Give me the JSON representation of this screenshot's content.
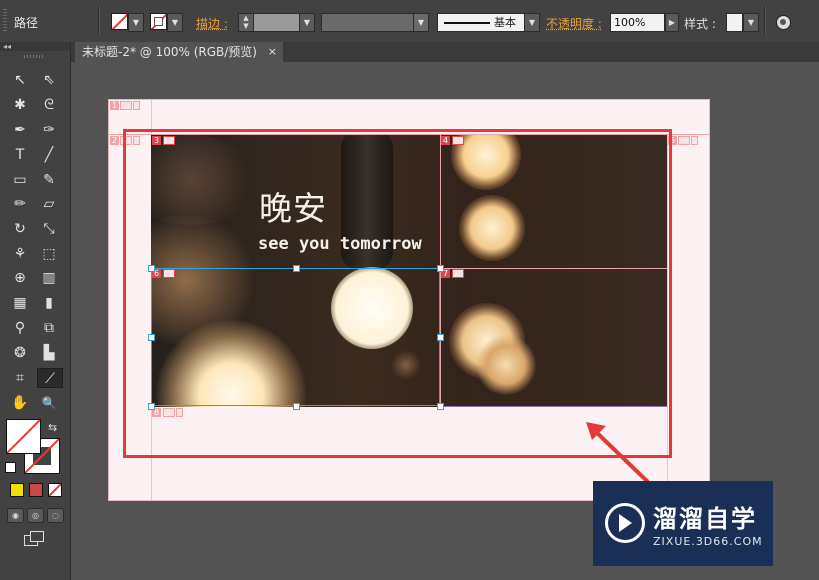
{
  "control_bar": {
    "tool_name": "路径",
    "stroke_label": "描边 :",
    "stroke_profile_label": "基本",
    "opacity_label": "不透明度 :",
    "opacity_value": "100%",
    "style_label": "样式 :",
    "fill_swatch": "none",
    "stroke_swatch": "none"
  },
  "document_tab": {
    "title": "未标题-2* @ 100% (RGB/预览)",
    "close_glyph": "×"
  },
  "toolbox": {
    "collapse_glyph": "◂◂",
    "tools": [
      {
        "name": "selection-tool-icon",
        "glyph": "↖"
      },
      {
        "name": "direct-selection-tool-icon",
        "glyph": "⇖"
      },
      {
        "name": "magic-wand-tool-icon",
        "glyph": "✱"
      },
      {
        "name": "lasso-tool-icon",
        "glyph": "ᘓ"
      },
      {
        "name": "pen-tool-icon",
        "glyph": "✒"
      },
      {
        "name": "curvature-tool-icon",
        "glyph": "✑"
      },
      {
        "name": "type-tool-icon",
        "glyph": "T"
      },
      {
        "name": "line-tool-icon",
        "glyph": "╱"
      },
      {
        "name": "rectangle-tool-icon",
        "glyph": "▭"
      },
      {
        "name": "paintbrush-tool-icon",
        "glyph": "✎"
      },
      {
        "name": "pencil-tool-icon",
        "glyph": "✏"
      },
      {
        "name": "eraser-tool-icon",
        "glyph": "▱"
      },
      {
        "name": "rotate-tool-icon",
        "glyph": "↻"
      },
      {
        "name": "scale-tool-icon",
        "glyph": "⤡"
      },
      {
        "name": "warp-tool-icon",
        "glyph": "⚘"
      },
      {
        "name": "free-transform-tool-icon",
        "glyph": "⬚"
      },
      {
        "name": "shape-builder-tool-icon",
        "glyph": "⊕"
      },
      {
        "name": "graph-tool-icon",
        "glyph": "▥"
      },
      {
        "name": "mesh-tool-icon",
        "glyph": "▦"
      },
      {
        "name": "gradient-tool-icon",
        "glyph": "▮"
      },
      {
        "name": "eyedropper-tool-icon",
        "glyph": "⚲"
      },
      {
        "name": "blend-tool-icon",
        "glyph": "⧉"
      },
      {
        "name": "symbol-sprayer-tool-icon",
        "glyph": "❂"
      },
      {
        "name": "column-graph-tool-icon",
        "glyph": "▙"
      },
      {
        "name": "artboard-tool-icon",
        "glyph": "⌗"
      },
      {
        "name": "slice-tool-icon",
        "glyph": "⟋"
      },
      {
        "name": "hand-tool-icon",
        "glyph": "✋"
      },
      {
        "name": "zoom-tool-icon",
        "glyph": "🔍"
      }
    ],
    "swap_glyph": "⇆",
    "color_modes": [
      "#f0e000",
      "#c84848",
      "none"
    ]
  },
  "canvas": {
    "title_main": "晚安",
    "title_sub": "see you tomorrow",
    "cell_labels": [
      "1",
      "2",
      "3",
      "4",
      "5",
      "6",
      "7",
      "8"
    ],
    "accent_red": "#e23a3a",
    "selection_blue": "#3aa0dd"
  },
  "watermark": {
    "name": "溜溜自学",
    "url": "ZIXUE.3D66.COM"
  }
}
